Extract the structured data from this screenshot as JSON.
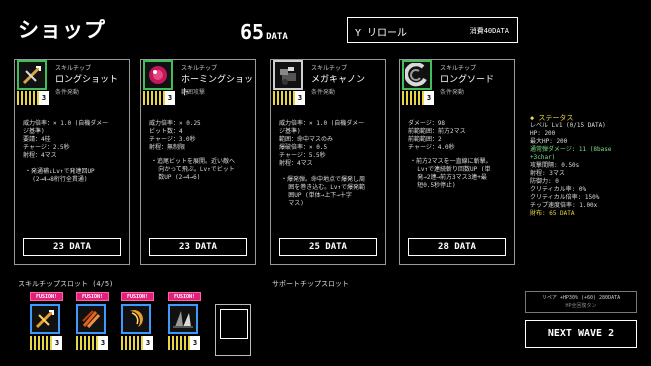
{
  "header": {
    "title": "ショップ",
    "data_amount": "65",
    "data_unit": "DATA",
    "reroll_label": "Y リロール",
    "reroll_cost": "消費40DATA"
  },
  "cards": [
    {
      "category": "スキルチップ",
      "name": "ロングショット",
      "condition": "条件発動",
      "frame_color": "#3fbf5a",
      "icon": "crossbow-icon",
      "level": "3",
      "stats": [
        "威力倍率：× 1.0 (自機ダメー",
        "ジ基準)",
        "要請：4桂",
        "チャージ：2.5秒",
        "射程：4マス"
      ],
      "desc": "・発通補↓Lv↑で発連回UP\n  (2→4→8桁行全貫通)",
      "price": "23 DATA"
    },
    {
      "category": "スキルチップ",
      "name": "ホーミングショット",
      "condition": "範囲攻撃",
      "frame_color": "#3fbf5a",
      "icon": "homing-orb-icon",
      "level": "3",
      "stats": [
        "威力倍率：× 0.25",
        "ビット数：4",
        "チャージ：3.0秒",
        "射程：無制限"
      ],
      "desc": "・追尾ビットを展開。近い敵へ\n  向かって飛ぶ。Lv↑でビット\n  数UP (2→4→6)",
      "price": "23 DATA"
    },
    {
      "category": "スキルチップ",
      "name": "メガキャノン",
      "condition": "条件発動",
      "frame_color": "#cfcfcf",
      "icon": "cannon-icon",
      "level": "3",
      "stats": [
        "威力倍率：× 1.0 (自機ダメー",
        "ジ基準)",
        "範囲：命中マスのみ",
        "爆破倍率：× 0.5",
        "チャージ：5.5秒",
        "射程：4マス"
      ],
      "desc": "・爆発弾。命中地点で爆発し周\n  囲を巻き込む。Lv↑で爆発範\n  囲UP (単体→上下→十字\n  マス)",
      "price": "25 DATA"
    },
    {
      "category": "スキルチップ",
      "name": "ロングソード",
      "condition": "条件発動",
      "frame_color": "#3fbf5a",
      "icon": "longsword-icon",
      "level": "3",
      "stats": [
        "ダメージ：98",
        "前範範囲：前方2マス",
        "前範範囲：2",
        "チャージ：4.0秒"
      ],
      "desc": "・前方2マスを一直線に斬撃。\n  Lv↑で連続斬り回数UP (単\n  発→2連→前方3マス3連+最\n  短0.5秒停止)",
      "price": "28 DATA"
    }
  ],
  "status": {
    "heading": "◆ ステータス",
    "lines": [
      {
        "text": "レベル Lv1 (0/15 DATA)",
        "tone": "normal"
      },
      {
        "text": "HP: 200",
        "tone": "normal"
      },
      {
        "text": "最大HP: 200",
        "tone": "normal"
      },
      {
        "text": "通常弾ダメージ: 11 (8base",
        "tone": "green"
      },
      {
        "text": "+3char)",
        "tone": "green"
      },
      {
        "text": "攻撃間隔: 0.50s",
        "tone": "normal"
      },
      {
        "text": "射程: 3マス",
        "tone": "normal"
      },
      {
        "text": "防御力: 0",
        "tone": "normal"
      },
      {
        "text": "クリティカル率: 0%",
        "tone": "normal"
      },
      {
        "text": "クリティカル倍率: 150%",
        "tone": "normal"
      },
      {
        "text": "チップ速度倍率: 1.00x",
        "tone": "normal"
      },
      {
        "text": "財布: 65 DATA",
        "tone": "yellow"
      }
    ]
  },
  "slots": {
    "label": "スキルチップスロット (4/5)",
    "fusion_label": "FUSION!",
    "items": [
      {
        "icon": "crossbow-icon",
        "level": "3"
      },
      {
        "icon": "claw-slash-icon",
        "level": "3"
      },
      {
        "icon": "crescent-slash-icon",
        "level": "3"
      },
      {
        "icon": "longsword-icon",
        "level": "3"
      }
    ]
  },
  "support": {
    "label": "サポートチップスロット",
    "line1": "リペア +HP30% (+60) 280DATA",
    "line2": "HP全回復タン"
  },
  "next_wave": "NEXT WAVE 2"
}
